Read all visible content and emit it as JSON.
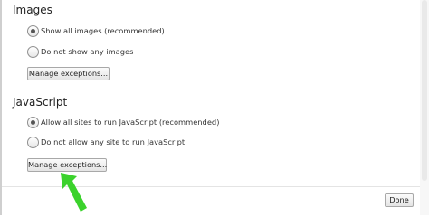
{
  "images": {
    "title": "Images",
    "options": [
      {
        "label": "Show all images (recommended)",
        "checked": true
      },
      {
        "label": "Do not show any images",
        "checked": false
      }
    ],
    "manage_label": "Manage exceptions..."
  },
  "javascript": {
    "title": "JavaScript",
    "options": [
      {
        "label": "Allow all sites to run JavaScript (recommended)",
        "checked": true
      },
      {
        "label": "Do not allow any site to run JavaScript",
        "checked": false
      }
    ],
    "manage_label": "Manage exceptions..."
  },
  "footer": {
    "done_label": "Done"
  },
  "annotation": {
    "arrow_color": "#3bd22c",
    "arrow_icon": "arrow-up-left-icon"
  }
}
